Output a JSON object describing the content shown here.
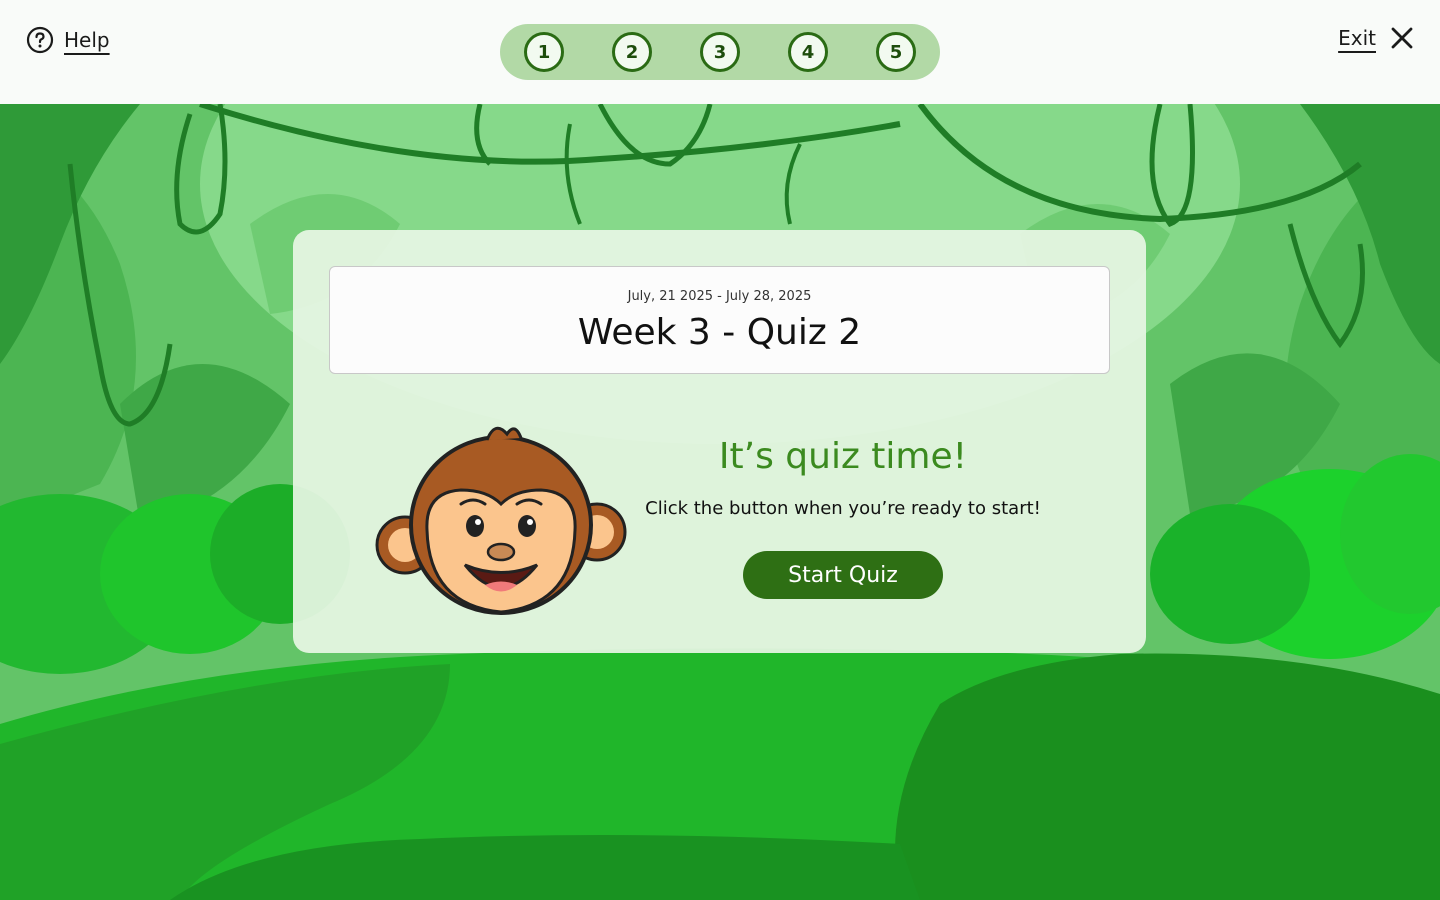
{
  "header": {
    "help_label": "Help",
    "exit_label": "Exit",
    "steps": [
      "1",
      "2",
      "3",
      "4",
      "5"
    ]
  },
  "quiz": {
    "date_range": "July, 21 2025 - July 28, 2025",
    "title": "Week 3 - Quiz 2",
    "headline": "It’s quiz time!",
    "instruction": "Click the button when you’re ready to start!",
    "start_label": "Start Quiz"
  },
  "icons": {
    "help": "question-circle-icon",
    "exit": "close-icon",
    "mascot": "monkey-mascot"
  },
  "colors": {
    "primary": "#2e6f14",
    "headline": "#3b8a1f",
    "stepper_bg": "#b2d9a6",
    "jungle_dark": "#1a8f1e"
  }
}
